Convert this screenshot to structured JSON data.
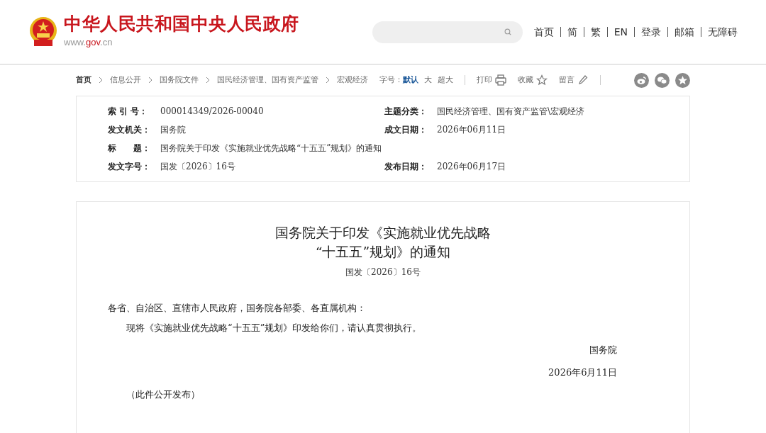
{
  "header": {
    "site_title": "中华人民共和国中央人民政府",
    "site_url_parts": [
      "www.",
      "gov",
      ".cn"
    ],
    "top_links": [
      "首页",
      "简",
      "繁",
      "EN",
      "登录",
      "邮箱",
      "无障碍"
    ]
  },
  "breadcrumb": [
    "首页",
    "信息公开",
    "国务院文件",
    "国民经济管理、国有资产监管",
    "宏观经济"
  ],
  "font_size": {
    "label": "字号：",
    "options": [
      {
        "label": "默认",
        "selected": true
      },
      {
        "label": "大",
        "selected": false
      },
      {
        "label": "超大",
        "selected": false
      }
    ]
  },
  "actions": [
    {
      "label": "打印",
      "kind": "print"
    },
    {
      "label": "收藏",
      "kind": "favorite"
    },
    {
      "label": "留言",
      "kind": "comment"
    }
  ],
  "share": [
    {
      "kind": "weibo"
    },
    {
      "kind": "wechat"
    },
    {
      "kind": "star"
    }
  ],
  "metadata": [
    {
      "left": {
        "label": "索 引 号：",
        "value": "000014349/2026-00040"
      },
      "right": {
        "label": "主题分类：",
        "value": "国民经济管理、国有资产监管\\宏观经济"
      }
    },
    {
      "left": {
        "label": "发文机关：",
        "value": "国务院"
      },
      "right": {
        "label": "成文日期：",
        "value": "2026年06月11日"
      }
    },
    {
      "left": {
        "label": "标　　题：",
        "value": "国务院关于印发《实施就业优先战略“十五五”规划》的通知"
      }
    },
    {
      "left": {
        "label": "发文字号：",
        "value": "国发〔2026〕16号"
      },
      "right": {
        "label": "发布日期：",
        "value": "2026年06月17日"
      }
    }
  ],
  "document": {
    "title_lines": [
      "国务院关于印发《实施就业优先战略",
      "“十五五”规划》的通知"
    ],
    "doc_number": "国发〔2026〕16号",
    "paragraphs": [
      {
        "kind": "salutation",
        "text": "各省、自治区、直辖市人民政府，国务院各部委、各直属机构："
      },
      {
        "kind": "indent",
        "text": "现将《实施就业优先战略“十五五”规划》印发给你们，请认真贯彻执行。"
      },
      {
        "kind": "signature",
        "text": "国务院"
      },
      {
        "kind": "signature",
        "text": "2026年6月11日"
      },
      {
        "kind": "note",
        "text": "（此件公开发布）"
      }
    ]
  }
}
